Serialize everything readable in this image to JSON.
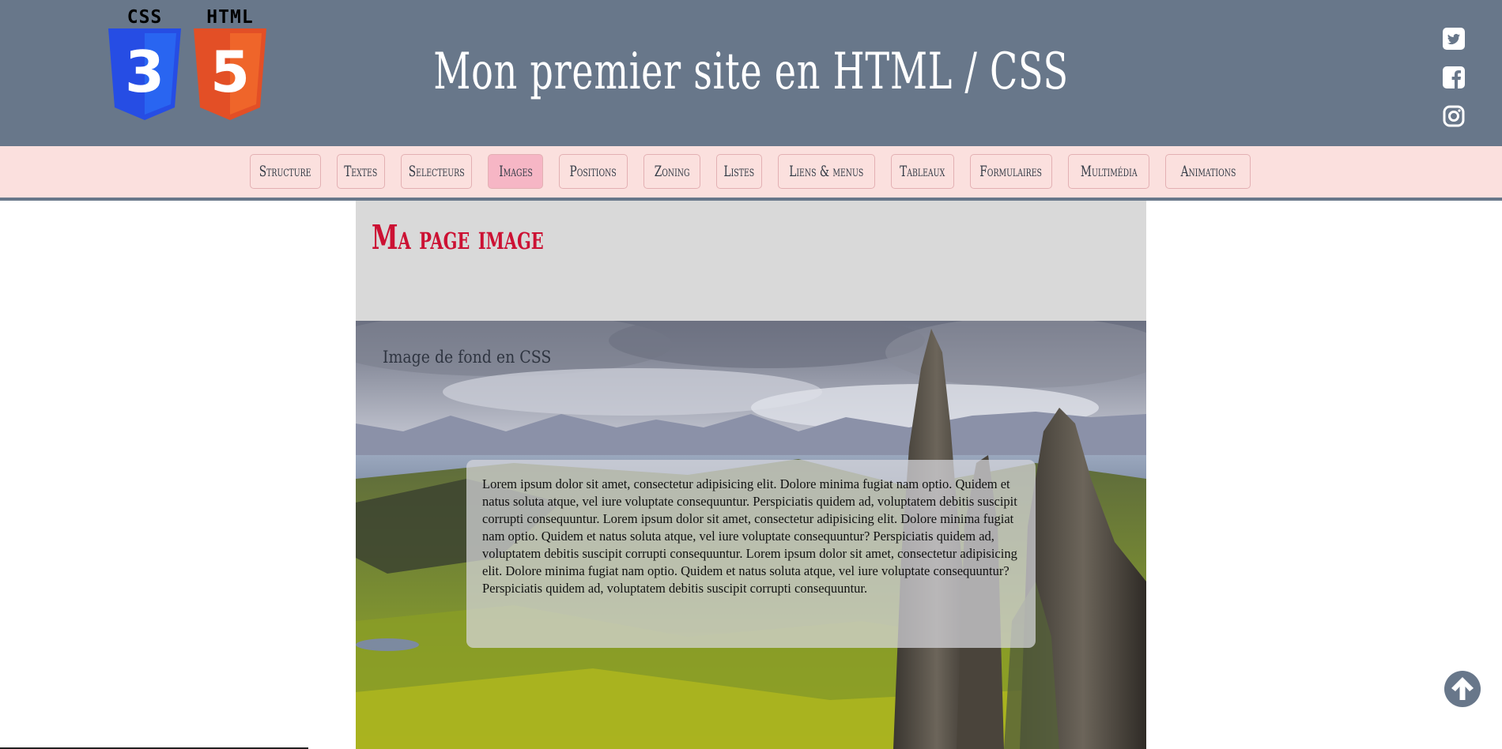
{
  "header": {
    "title": "Mon premier site en HTML / CSS",
    "logos": [
      {
        "label": "CSS",
        "digit": "3",
        "icon": "css3-shield-icon"
      },
      {
        "label": "HTML",
        "digit": "5",
        "icon": "html5-shield-icon"
      }
    ],
    "social": [
      "twitter-icon",
      "facebook-icon",
      "instagram-icon"
    ]
  },
  "nav": {
    "items": [
      {
        "label": "Structure",
        "active": false
      },
      {
        "label": "Textes",
        "active": false
      },
      {
        "label": "Selecteurs",
        "active": false
      },
      {
        "label": "Images",
        "active": true
      },
      {
        "label": "Positions",
        "active": false
      },
      {
        "label": "Zoning",
        "active": false
      },
      {
        "label": "Listes",
        "active": false
      },
      {
        "label": "Liens & menus",
        "active": false
      },
      {
        "label": "Tableaux",
        "active": false
      },
      {
        "label": "Formulaires",
        "active": false
      },
      {
        "label": "Multimédia",
        "active": false
      },
      {
        "label": "Animations",
        "active": false
      }
    ]
  },
  "main": {
    "page_title": "Ma page image",
    "bg_caption": "Image de fond en CSS",
    "lorem": "Lorem ipsum dolor sit amet, consectetur adipisicing elit. Dolore minima fugiat nam optio. Quidem et natus soluta atque, vel iure voluptate consequuntur. Perspiciatis quidem ad, voluptatem debitis suscipit corrupti consequuntur. Lorem ipsum dolor sit amet, consectetur adipisicing elit. Dolore minima fugiat nam optio. Quidem et natus soluta atque, vel iure voluptate consequuntur? Perspiciatis quidem ad, voluptatem debitis suscipit corrupti consequuntur. Lorem ipsum dolor sit amet, consectetur adipisicing elit. Dolore minima fugiat nam optio. Quidem et natus soluta atque, vel iure voluptate consequuntur? Perspiciatis quidem ad, voluptatem debitis suscipit corrupti consequuntur."
  },
  "colors": {
    "header_bg": "#68778a",
    "nav_bg": "#fbe0de",
    "nav_active_bg": "#f6b6c5",
    "title_red": "#cc1133",
    "main_bg": "#d9d9d9"
  },
  "scroll_top_icon": "arrow-circle-up-icon"
}
